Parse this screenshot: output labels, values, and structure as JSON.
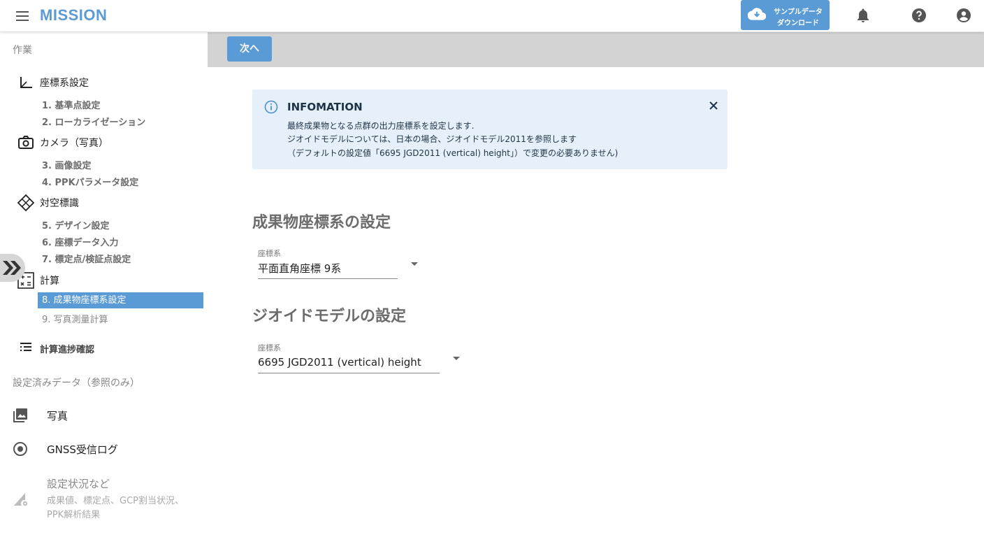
{
  "header": {
    "app_title": "MISSION",
    "download_button": {
      "line1": "サンプルデータ",
      "line2": "ダウンロード"
    },
    "icons": [
      "menu-icon",
      "cloud-download-icon",
      "bell-icon",
      "help-icon",
      "account-icon"
    ]
  },
  "sidebar": {
    "work_label": "作業",
    "categories": {
      "coord": {
        "label": "座標系設定",
        "icon": "axis-icon"
      },
      "camera": {
        "label": "カメラ（写真）",
        "icon": "camera-icon"
      },
      "target": {
        "label": "対空標識",
        "icon": "target-diamond-icon"
      },
      "calc": {
        "label": "計算",
        "icon": "calculator-icon"
      },
      "progress": {
        "label": "計算進捗確認",
        "icon": "list-icon"
      }
    },
    "steps": [
      "1. 基準点設定",
      "2. ローカライゼーション",
      "3. 画像設定",
      "4. PPKパラメータ設定",
      "5. デザイン設定",
      "6. 座標データ入力",
      "7. 標定点/検証点設定",
      "8. 成果物座標系設定",
      "9. 写真測量計算"
    ],
    "active_step_index": 7,
    "reference_label": "設定済みデータ（参照のみ）",
    "reference_items": {
      "photo": {
        "label": "写真",
        "icon": "image-icon"
      },
      "gnss": {
        "label": "GNSS受信ログ",
        "icon": "radio-button-icon"
      },
      "status": {
        "label": "設定状況など",
        "sub1": "成果値、標定点、GCP割当状況、",
        "sub2": "PPK解析結果",
        "icon": "signal-settings-icon"
      }
    },
    "collapse_icon": "double-chevron-right-icon"
  },
  "toolbar": {
    "next_label": "次へ"
  },
  "info": {
    "title": "INFOMATION",
    "line1": "最終成果物となる点群の出力座標系を設定します.",
    "line2": "ジオイドモデルについては、日本の場合、ジオイドモデル2011を参照します",
    "line3": "（デフォルトの設定値「6695 JGD2011 (vertical) height」）で変更の必要ありません)",
    "icon": "info-icon",
    "close_icon": "close-icon"
  },
  "output_crs": {
    "section_title": "成果物座標系の設定",
    "field_label": "座標系",
    "value": "平面直角座標 9系"
  },
  "geoid": {
    "section_title": "ジオイドモデルの設定",
    "field_label": "座標系",
    "value": "6695 JGD2011 (vertical) height"
  },
  "colors": {
    "accent": "#5b9bd5",
    "toolbar_bg": "#d3d3d3",
    "info_bg": "#e6f0fa"
  }
}
